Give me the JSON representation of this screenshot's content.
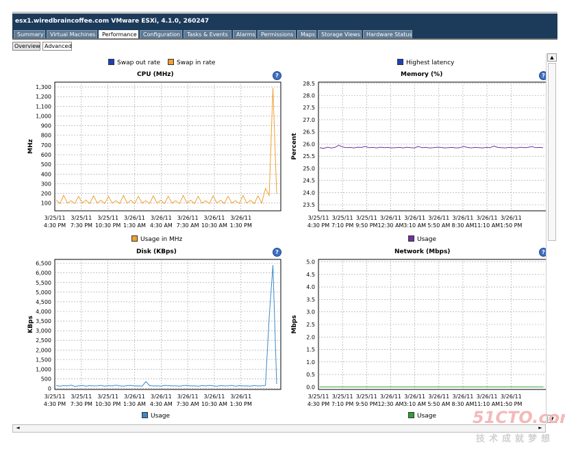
{
  "window": {
    "title": "esx1.wiredbraincoffee.com VMware ESXi, 4.1.0, 260247"
  },
  "tabs": [
    {
      "label": "Summary"
    },
    {
      "label": "Virtual Machines"
    },
    {
      "label": "Performance",
      "active": true
    },
    {
      "label": "Configuration"
    },
    {
      "label": "Tasks & Events"
    },
    {
      "label": "Alarms"
    },
    {
      "label": "Permissions"
    },
    {
      "label": "Maps"
    },
    {
      "label": "Storage Views"
    },
    {
      "label": "Hardware Status"
    }
  ],
  "views": {
    "overview": "Overview",
    "advanced": "Advanced"
  },
  "colors": {
    "navy": "#1c3a5a",
    "orange": "#f0a030",
    "blue": "#1a40c0",
    "purple": "#7030a0",
    "steel": "#3a88c8",
    "green": "#30a030"
  },
  "icons": [
    "help-icon",
    "scroll-up-icon",
    "scroll-down-icon",
    "scroll-left-icon",
    "scroll-right-icon"
  ],
  "watermark": {
    "brand": "51CTO.com",
    "sub": "技术成就梦想"
  },
  "charts": {
    "cpu": {
      "title": "CPU (MHz)",
      "ylabel": "MHz",
      "legend_top": [
        {
          "name": "Swap out rate",
          "color": "#1a40c0"
        },
        {
          "name": "Swap in rate",
          "color": "#f0a030"
        }
      ],
      "legend_bottom": [
        {
          "name": "Usage in MHz",
          "color": "#f0a030"
        }
      ],
      "y_ticks": [
        "1,300",
        "1,200",
        "1,100",
        "1,000",
        "900",
        "800",
        "700",
        "600",
        "500",
        "400",
        "300",
        "200",
        "100"
      ],
      "x_ticks": [
        [
          "3/25/11",
          "4:30 PM"
        ],
        [
          "3/25/11",
          "7:30 PM"
        ],
        [
          "3/25/11",
          "10:30 PM"
        ],
        [
          "3/26/11",
          "1:30 AM"
        ],
        [
          "3/26/11",
          "4:30 AM"
        ],
        [
          "3/26/11",
          "7:30 AM"
        ],
        [
          "3/26/11",
          "10:30 AM"
        ],
        [
          "3/26/11",
          "1:30 PM"
        ]
      ]
    },
    "memory": {
      "title": "Memory (%)",
      "ylabel": "Percent",
      "legend_top": [
        {
          "name": "Highest latency",
          "color": "#1a40c0"
        }
      ],
      "legend_bottom": [
        {
          "name": "Usage",
          "color": "#7030a0"
        }
      ],
      "y_ticks": [
        "28.5",
        "28.0",
        "27.5",
        "27.0",
        "26.5",
        "26.0",
        "25.5",
        "25.0",
        "24.5",
        "24.0",
        "23.5"
      ],
      "x_ticks": [
        [
          "3/25/11",
          "4:30 PM"
        ],
        [
          "3/25/11",
          "7:10 PM"
        ],
        [
          "3/25/11",
          "9:50 PM"
        ],
        [
          "3/26/11",
          "12:30 AM"
        ],
        [
          "3/26/11",
          "3:10 AM"
        ],
        [
          "3/26/11",
          "5:50 AM"
        ],
        [
          "3/26/11",
          "8:30 AM"
        ],
        [
          "3/26/11",
          "11:10 AM"
        ],
        [
          "3/26/11",
          "1:50 PM"
        ]
      ]
    },
    "disk": {
      "title": "Disk (KBps)",
      "ylabel": "KBps",
      "legend_bottom": [
        {
          "name": "Usage",
          "color": "#3a88c8"
        }
      ],
      "y_ticks": [
        "6,500",
        "6,000",
        "5,500",
        "5,000",
        "4,500",
        "4,000",
        "3,500",
        "3,000",
        "2,500",
        "2,000",
        "1,500",
        "1,000",
        "500",
        "0"
      ],
      "x_ticks": [
        [
          "3/25/11",
          "4:30 PM"
        ],
        [
          "3/25/11",
          "7:30 PM"
        ],
        [
          "3/25/11",
          "10:30 PM"
        ],
        [
          "3/26/11",
          "1:30 AM"
        ],
        [
          "3/26/11",
          "4:30 AM"
        ],
        [
          "3/26/11",
          "7:30 AM"
        ],
        [
          "3/26/11",
          "10:30 AM"
        ],
        [
          "3/26/11",
          "1:30 PM"
        ]
      ]
    },
    "network": {
      "title": "Network (Mbps)",
      "ylabel": "Mbps",
      "legend_bottom": [
        {
          "name": "Usage",
          "color": "#30a030"
        }
      ],
      "y_ticks": [
        "5.0",
        "4.5",
        "4.0",
        "3.5",
        "3.0",
        "2.5",
        "2.0",
        "1.5",
        "1.0",
        "0.5",
        "0.0"
      ],
      "x_ticks": [
        [
          "3/25/11",
          "4:30 PM"
        ],
        [
          "3/25/11",
          "7:10 PM"
        ],
        [
          "3/25/11",
          "9:50 PM"
        ],
        [
          "3/26/11",
          "12:30 AM"
        ],
        [
          "3/26/11",
          "3:10 AM"
        ],
        [
          "3/26/11",
          "5:50 AM"
        ],
        [
          "3/26/11",
          "8:30 AM"
        ],
        [
          "3/26/11",
          "11:10 AM"
        ],
        [
          "3/26/11",
          "1:50 PM"
        ]
      ]
    }
  },
  "chart_data": [
    {
      "type": "line",
      "title": "CPU (MHz)",
      "ylabel": "MHz",
      "ylim": [
        20,
        1350
      ],
      "series": [
        {
          "name": "Usage in MHz",
          "values": [
            130,
            95,
            180,
            100,
            125,
            95,
            170,
            100,
            130,
            95,
            175,
            100,
            130,
            95,
            170,
            100,
            125,
            95,
            180,
            100,
            130,
            95,
            170,
            100,
            125,
            95,
            175,
            100,
            130,
            95,
            170,
            100,
            125,
            95,
            180,
            100,
            130,
            95,
            170,
            100,
            125,
            95,
            175,
            100,
            130,
            95,
            170,
            100,
            125,
            95,
            180,
            100,
            130,
            95,
            175,
            100,
            250,
            180,
            1290,
            200
          ]
        }
      ]
    },
    {
      "type": "line",
      "title": "Memory (%)",
      "ylabel": "Percent",
      "ylim": [
        23.25,
        28.55
      ],
      "series": [
        {
          "name": "Usage",
          "values": [
            25.85,
            25.82,
            25.87,
            25.84,
            25.86,
            25.95,
            25.88,
            25.85,
            25.86,
            25.84,
            25.87,
            25.86,
            25.9,
            25.85,
            25.86,
            25.84,
            25.87,
            25.85,
            25.86,
            25.84,
            25.85,
            25.86,
            25.84,
            25.87,
            25.85,
            25.84,
            25.9,
            25.85,
            25.86,
            25.84,
            25.85,
            25.87,
            25.86,
            25.84,
            25.85,
            25.86,
            25.84,
            25.85,
            25.9,
            25.86,
            25.84,
            25.86,
            25.85,
            25.84,
            25.86,
            25.85,
            25.92,
            25.86,
            25.85,
            25.84,
            25.86,
            25.85,
            25.84,
            25.87,
            25.85,
            25.86,
            25.9,
            25.85,
            25.86,
            25.85
          ]
        }
      ]
    },
    {
      "type": "line",
      "title": "Disk (KBps)",
      "ylabel": "KBps",
      "ylim": [
        -50,
        6700
      ],
      "series": [
        {
          "name": "Usage",
          "values": [
            160,
            120,
            150,
            130,
            170,
            110,
            140,
            160,
            120,
            150,
            130,
            140,
            160,
            120,
            150,
            130,
            170,
            140,
            120,
            150,
            160,
            130,
            140,
            120,
            360,
            150,
            130,
            140,
            120,
            160,
            150,
            130,
            140,
            120,
            150,
            160,
            130,
            140,
            120,
            150,
            130,
            160,
            140,
            120,
            150,
            130,
            140,
            160,
            120,
            150,
            130,
            140,
            120,
            150,
            130,
            140,
            160,
            3700,
            6400,
            230
          ]
        }
      ]
    },
    {
      "type": "line",
      "title": "Network (Mbps)",
      "ylabel": "Mbps",
      "ylim": [
        -0.1,
        5.1
      ],
      "series": [
        {
          "name": "Usage",
          "values": [
            0,
            0,
            0,
            0,
            0,
            0,
            0,
            0,
            0,
            0,
            0,
            0,
            0,
            0,
            0,
            0,
            0,
            0,
            0,
            0,
            0,
            0,
            0,
            0,
            0,
            0,
            0,
            0,
            0,
            0,
            0,
            0,
            0,
            0,
            0,
            0,
            0,
            0,
            0,
            0,
            0,
            0,
            0,
            0,
            0,
            0,
            0,
            0,
            0,
            0,
            0,
            0,
            0,
            0,
            0,
            0,
            0,
            0,
            0,
            0
          ]
        }
      ]
    }
  ]
}
